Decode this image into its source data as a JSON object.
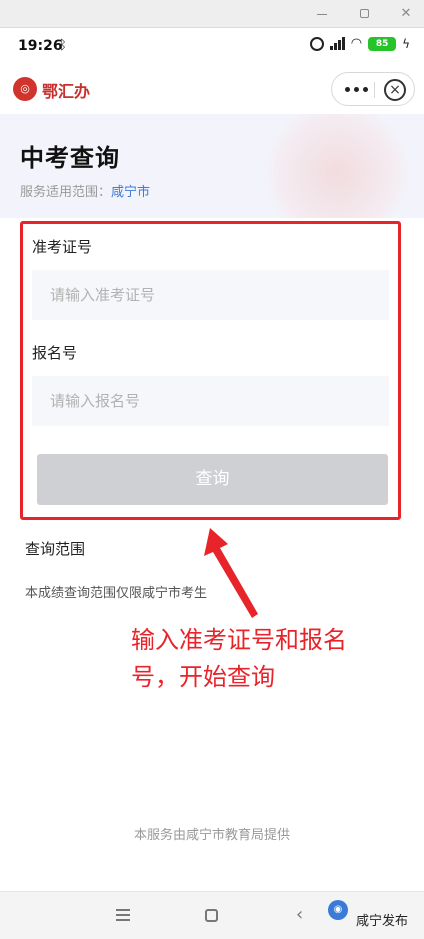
{
  "status_bar": {
    "time": "19:26",
    "battery": "85"
  },
  "app_header": {
    "logo_text": "鄂汇办"
  },
  "banner": {
    "title": "中考查询",
    "scope_label": "服务适用范围：",
    "scope_value": "咸宁市"
  },
  "form": {
    "exam_label": "准考证号",
    "exam_placeholder": "请输入准考证号",
    "exam_value": "",
    "reg_label": "报名号",
    "reg_placeholder": "请输入报名号",
    "reg_value": "",
    "query_button": "查询"
  },
  "info": {
    "title": "查询范围",
    "text": "本成绩查询范围仅限咸宁市考生"
  },
  "annotation": {
    "line1": "输入准考证号和报名",
    "line2": "号，开始查询"
  },
  "footer": {
    "text": "本服务由咸宁市教育局提供"
  },
  "watermark": {
    "text": "咸宁发布"
  },
  "colors": {
    "annotation_red": "#e8242b",
    "brand_red": "#c9302c",
    "link_blue": "#3e7ad6"
  }
}
